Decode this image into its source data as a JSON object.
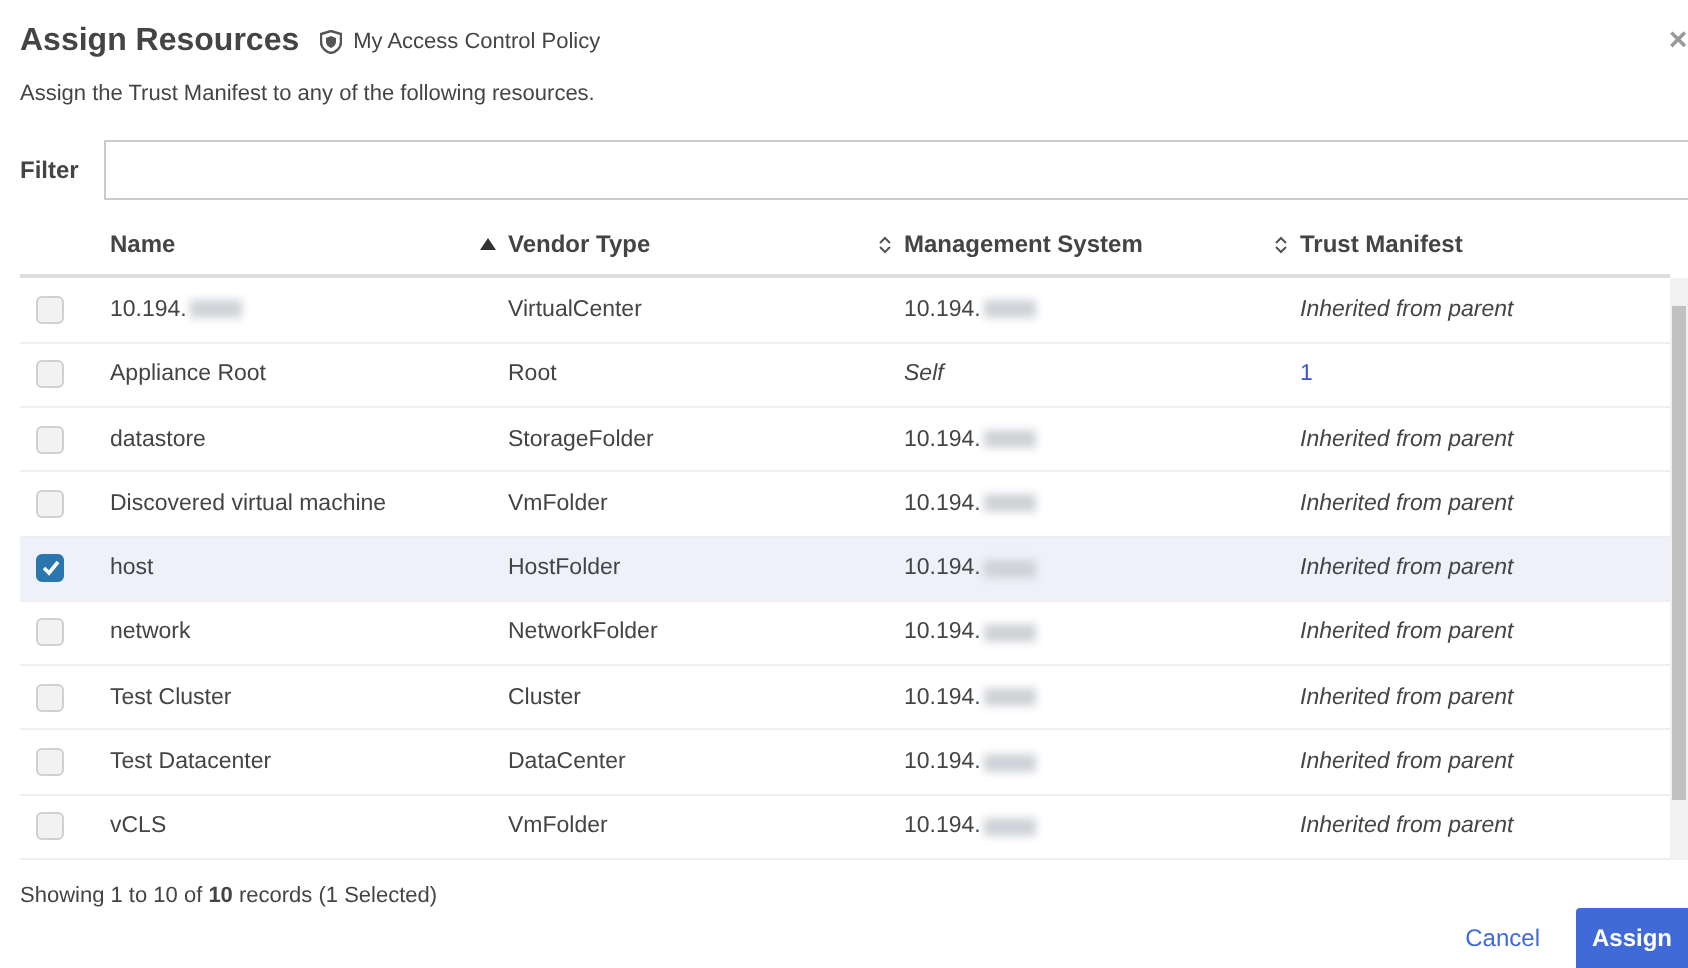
{
  "dialog": {
    "title": "Assign Resources",
    "policy": "My Access Control Policy",
    "close": "×",
    "description": "Assign the Trust Manifest to any of the following resources."
  },
  "filter": {
    "label": "Filter"
  },
  "table": {
    "columns": [
      {
        "label": "Name",
        "sorted": true
      },
      {
        "label": "Vendor Type",
        "sorted": false
      },
      {
        "label": "Management System",
        "sorted": false
      },
      {
        "label": "Trust Manifest"
      }
    ],
    "rows": [
      {
        "checked": false,
        "selected": false,
        "name": {
          "text": "10.194.",
          "kind": "address"
        },
        "vendor_type": "VirtualCenter",
        "management_system": {
          "text": "10.194.",
          "kind": "address"
        },
        "trust_manifest": {
          "text": "Inherited from parent",
          "kind": "inherited"
        }
      },
      {
        "checked": false,
        "selected": false,
        "name": {
          "text": "Appliance Root",
          "kind": "plain"
        },
        "vendor_type": "Root",
        "management_system": {
          "text": "Self",
          "kind": "self"
        },
        "trust_manifest": {
          "text": "1",
          "kind": "link"
        }
      },
      {
        "checked": false,
        "selected": false,
        "name": {
          "text": "datastore",
          "kind": "plain"
        },
        "vendor_type": "StorageFolder",
        "management_system": {
          "text": "10.194.",
          "kind": "address"
        },
        "trust_manifest": {
          "text": "Inherited from parent",
          "kind": "inherited"
        }
      },
      {
        "checked": false,
        "selected": false,
        "name": {
          "text": "Discovered virtual machine",
          "kind": "plain"
        },
        "vendor_type": "VmFolder",
        "management_system": {
          "text": "10.194.",
          "kind": "address"
        },
        "trust_manifest": {
          "text": "Inherited from parent",
          "kind": "inherited"
        }
      },
      {
        "checked": true,
        "selected": true,
        "name": {
          "text": "host",
          "kind": "plain"
        },
        "vendor_type": "HostFolder",
        "management_system": {
          "text": "10.194.",
          "kind": "address"
        },
        "trust_manifest": {
          "text": "Inherited from parent",
          "kind": "inherited"
        }
      },
      {
        "checked": false,
        "selected": false,
        "name": {
          "text": "network",
          "kind": "plain"
        },
        "vendor_type": "NetworkFolder",
        "management_system": {
          "text": "10.194.",
          "kind": "address"
        },
        "trust_manifest": {
          "text": "Inherited from parent",
          "kind": "inherited"
        }
      },
      {
        "checked": false,
        "selected": false,
        "name": {
          "text": "Test Cluster",
          "kind": "plain"
        },
        "vendor_type": "Cluster",
        "management_system": {
          "text": "10.194.",
          "kind": "address"
        },
        "trust_manifest": {
          "text": "Inherited from parent",
          "kind": "inherited"
        }
      },
      {
        "checked": false,
        "selected": false,
        "name": {
          "text": "Test Datacenter",
          "kind": "plain"
        },
        "vendor_type": "DataCenter",
        "management_system": {
          "text": "10.194.",
          "kind": "address"
        },
        "trust_manifest": {
          "text": "Inherited from parent",
          "kind": "inherited"
        }
      },
      {
        "checked": false,
        "selected": false,
        "name": {
          "text": "vCLS",
          "kind": "plain"
        },
        "vendor_type": "VmFolder",
        "management_system": {
          "text": "10.194.",
          "kind": "address"
        },
        "trust_manifest": {
          "text": "Inherited from parent",
          "kind": "inherited"
        }
      }
    ]
  },
  "status": "Showing 1 to 10 of **10** records (1 Selected)",
  "buttons": [
    {
      "label": "Cancel",
      "kind": "link"
    },
    {
      "label": "Assign",
      "kind": "primary"
    }
  ]
}
